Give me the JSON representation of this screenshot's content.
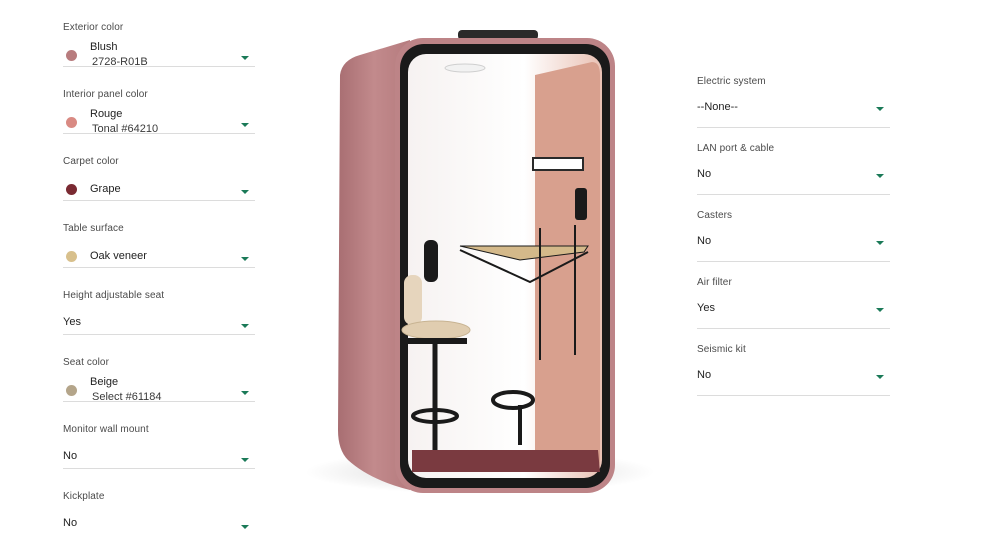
{
  "left_options": [
    {
      "label": "Exterior color",
      "value": "Blush",
      "sub": "2728-R01B",
      "swatch": "#b87c7e"
    },
    {
      "label": "Interior panel color",
      "value": "Rouge",
      "sub": "Tonal #64210",
      "swatch": "#d98a83"
    },
    {
      "label": "Carpet color",
      "value": "Grape",
      "sub": "",
      "swatch": "#7a2a32"
    },
    {
      "label": "Table surface",
      "value": "Oak veneer",
      "sub": "",
      "swatch": "#d8c08c"
    },
    {
      "label": "Height adjustable seat",
      "value": "Yes"
    },
    {
      "label": "Seat color",
      "value": "Beige",
      "sub": "Select #61184",
      "swatch": "#b4a58a"
    },
    {
      "label": "Monitor wall mount",
      "value": "No"
    },
    {
      "label": "Kickplate",
      "value": "No"
    }
  ],
  "right_options": [
    {
      "label": "Electric system",
      "value": "--None--"
    },
    {
      "label": "LAN port & cable",
      "value": "No"
    },
    {
      "label": "Casters",
      "value": "No"
    },
    {
      "label": "Air filter",
      "value": "Yes"
    },
    {
      "label": "Seismic kit",
      "value": "No"
    }
  ],
  "colors": {
    "accent": "#1b7a58",
    "booth_exterior": "#b87c7e",
    "booth_interior": "#d59a88",
    "frame": "#1a1a1a"
  }
}
